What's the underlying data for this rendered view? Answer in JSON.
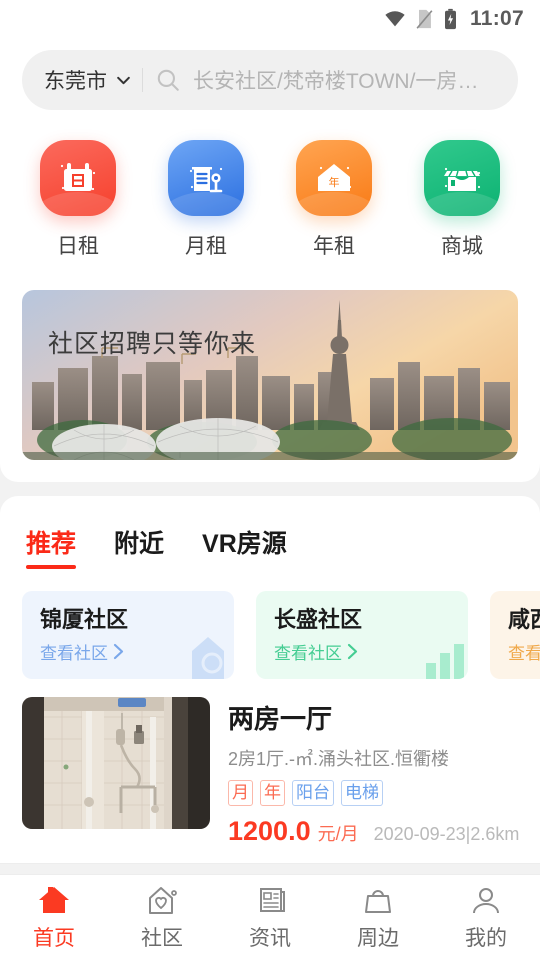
{
  "status_bar": {
    "time": "11:07",
    "icons": [
      "wifi-icon",
      "no-sim-icon",
      "battery-charging-icon"
    ]
  },
  "search": {
    "city": "东莞市",
    "city_chevron": "chevron-down-icon",
    "search_icon": "search-icon",
    "placeholder": "长安社区/梵帝楼TOWN/一房一厅",
    "value": ""
  },
  "quick_entries": [
    {
      "label": "日租",
      "icon": "calendar-day-icon",
      "color": "#f6402c"
    },
    {
      "label": "月租",
      "icon": "building-pin-icon",
      "color": "#2b6fe0"
    },
    {
      "label": "年租",
      "icon": "house-year-icon",
      "color": "#f97a15"
    },
    {
      "label": "商城",
      "icon": "shop-icon",
      "color": "#0cb272"
    }
  ],
  "banner": {
    "text": "社区招聘只等你来",
    "image": "city-skyline-sunset-photo"
  },
  "tabs": [
    {
      "label": "推荐",
      "active": true
    },
    {
      "label": "附近",
      "active": false
    },
    {
      "label": "VR房源",
      "active": false
    }
  ],
  "communities": [
    {
      "title": "锦厦社区",
      "link": "查看社区",
      "arrow": "chevron-right-icon",
      "theme": "blue",
      "decoration": "house-icon"
    },
    {
      "title": "长盛社区",
      "link": "查看社区",
      "arrow": "chevron-right-icon",
      "theme": "green",
      "decoration": "bar-chart-icon"
    },
    {
      "title": "咸西社区",
      "link": "查看社区",
      "arrow": "chevron-right-icon",
      "theme": "orange",
      "decoration": "none"
    }
  ],
  "listing": {
    "thumbnail": "bathroom-photo",
    "title": "两房一厅",
    "subtitle": "2房1厅.-㎡.涌头社区.恒衢楼",
    "tags": [
      {
        "label": "月",
        "style": "red"
      },
      {
        "label": "年",
        "style": "red"
      },
      {
        "label": "阳台",
        "style": "blue"
      },
      {
        "label": "电梯",
        "style": "blue"
      }
    ],
    "price": "1200.0",
    "price_unit": "元/月",
    "meta": "2020-09-23|2.6km"
  },
  "bottom_nav": [
    {
      "label": "首页",
      "icon": "home-icon",
      "active": true
    },
    {
      "label": "社区",
      "icon": "community-house-heart-icon",
      "active": false
    },
    {
      "label": "资讯",
      "icon": "news-icon",
      "active": false
    },
    {
      "label": "周边",
      "icon": "bag-icon",
      "active": false
    },
    {
      "label": "我的",
      "icon": "user-icon",
      "active": false
    }
  ],
  "colors": {
    "accent": "#fb3a22",
    "muted": "#8d8d8d",
    "page_bg": "#f2f2f2"
  }
}
